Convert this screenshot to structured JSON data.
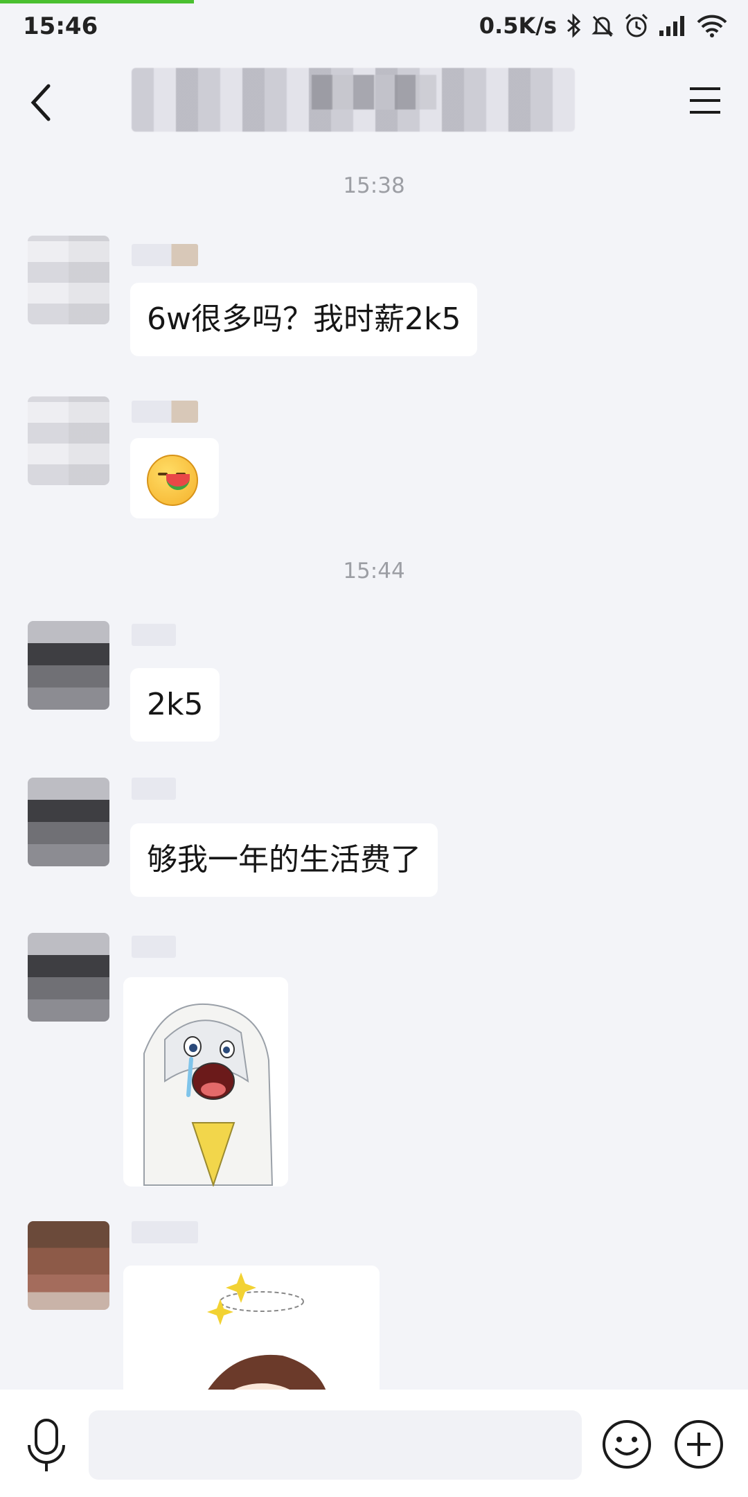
{
  "status_bar": {
    "time": "15:46",
    "speed": "0.5K/s",
    "icons": [
      "bluetooth-icon",
      "bell-muted-icon",
      "alarm-icon",
      "signal-icon",
      "wifi-icon"
    ]
  },
  "header": {
    "back_icon": "chevron-left-icon",
    "menu_icon": "hamburger-menu-icon"
  },
  "chat": {
    "timestamps": [
      "15:38",
      "15:44"
    ],
    "messages": [
      {
        "type": "text",
        "text": "6w很多吗？我时薪2k5"
      },
      {
        "type": "emoji",
        "icon": "watermelon-face-emoji-icon"
      },
      {
        "type": "text",
        "text": "2k5"
      },
      {
        "type": "text",
        "text": "够我一年的生活费了"
      },
      {
        "type": "sticker",
        "icon": "crying-anime-girl-sticker"
      },
      {
        "type": "sticker",
        "icon": "dizzy-anime-girl-sticker"
      }
    ]
  },
  "bottom_bar": {
    "icons": [
      "microphone-icon",
      "emoji-smile-icon",
      "plus-circle-icon"
    ],
    "input_placeholder": ""
  },
  "colors": {
    "background": "#f3f4f8",
    "bubble": "#ffffff",
    "progress": "#4ac030"
  }
}
